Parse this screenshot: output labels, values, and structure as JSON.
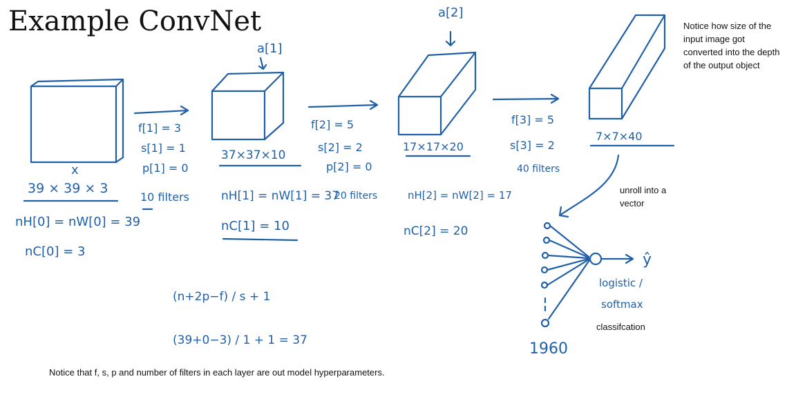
{
  "title": "Example ConvNet",
  "activations": {
    "a1": "a[1]",
    "a2": "a[2]"
  },
  "input": {
    "x": "x",
    "dims": "39 × 39 × 3",
    "nh_nw": "nH[0] = nW[0] = 39",
    "nc": "nC[0] = 3"
  },
  "layer1": {
    "f": "f[1] = 3",
    "s": "s[1] = 1",
    "p": "p[1] = 0",
    "filters": "10 filters",
    "dims": "37×37×10",
    "nh_nw": "nH[1] = nW[1] = 37",
    "nc": "nC[1] = 10"
  },
  "layer2": {
    "f": "f[2] = 5",
    "s": "s[2] = 2",
    "p": "p[2] = 0",
    "filters": "20 filters",
    "dims": "17×17×20",
    "nh_nw": "nH[2] = nW[2] = 17",
    "nc": "nC[2] = 20"
  },
  "layer3": {
    "f": "f[3] = 5",
    "s": "s[3] = 2",
    "filters": "40 filters",
    "dims": "7×7×40"
  },
  "formula": {
    "line1": "(n+2p−f) / s + 1",
    "line2": "(39+0−3) / 1 + 1 = 37"
  },
  "output": {
    "count": "1960",
    "yhat": "ŷ",
    "logistic": "logistic /",
    "softmax": "softmax"
  },
  "notes": {
    "depth": "Notice how size of the input image got converted into the depth of the output object",
    "unroll": "unroll into a vector",
    "classification": "classifcation",
    "hyperparams": "Notice that f, s, p and number of filters in each layer are out model hyperparameters."
  }
}
